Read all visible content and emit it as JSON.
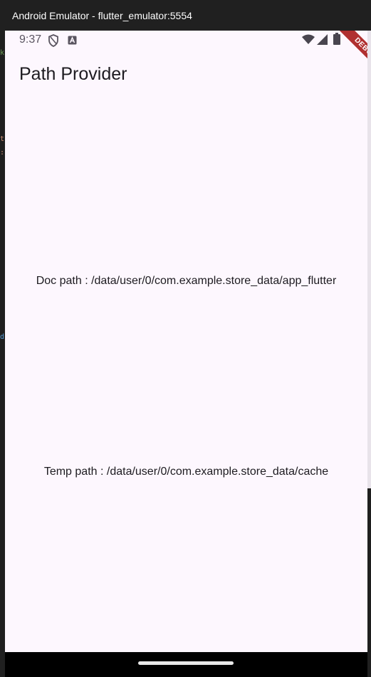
{
  "window": {
    "title": "Android Emulator - flutter_emulator:5554"
  },
  "status_bar": {
    "time": "9:37",
    "left_icons": [
      "shield-icon",
      "a-keyboard-icon"
    ],
    "right_icons": [
      "wifi-icon",
      "signal-icon",
      "battery-icon"
    ]
  },
  "app": {
    "title": "Path Provider",
    "doc_path": "Doc path : /data/user/0/com.example.store_data/app_flutter",
    "temp_path": "Temp path : /data/user/0/com.example.store_data/cache",
    "debug_banner": "DEBUG"
  },
  "colors": {
    "screen_background": "#fdf7fe",
    "title_bar": "#202020",
    "debug_ribbon": "#b03030",
    "text": "#1d1b20"
  }
}
